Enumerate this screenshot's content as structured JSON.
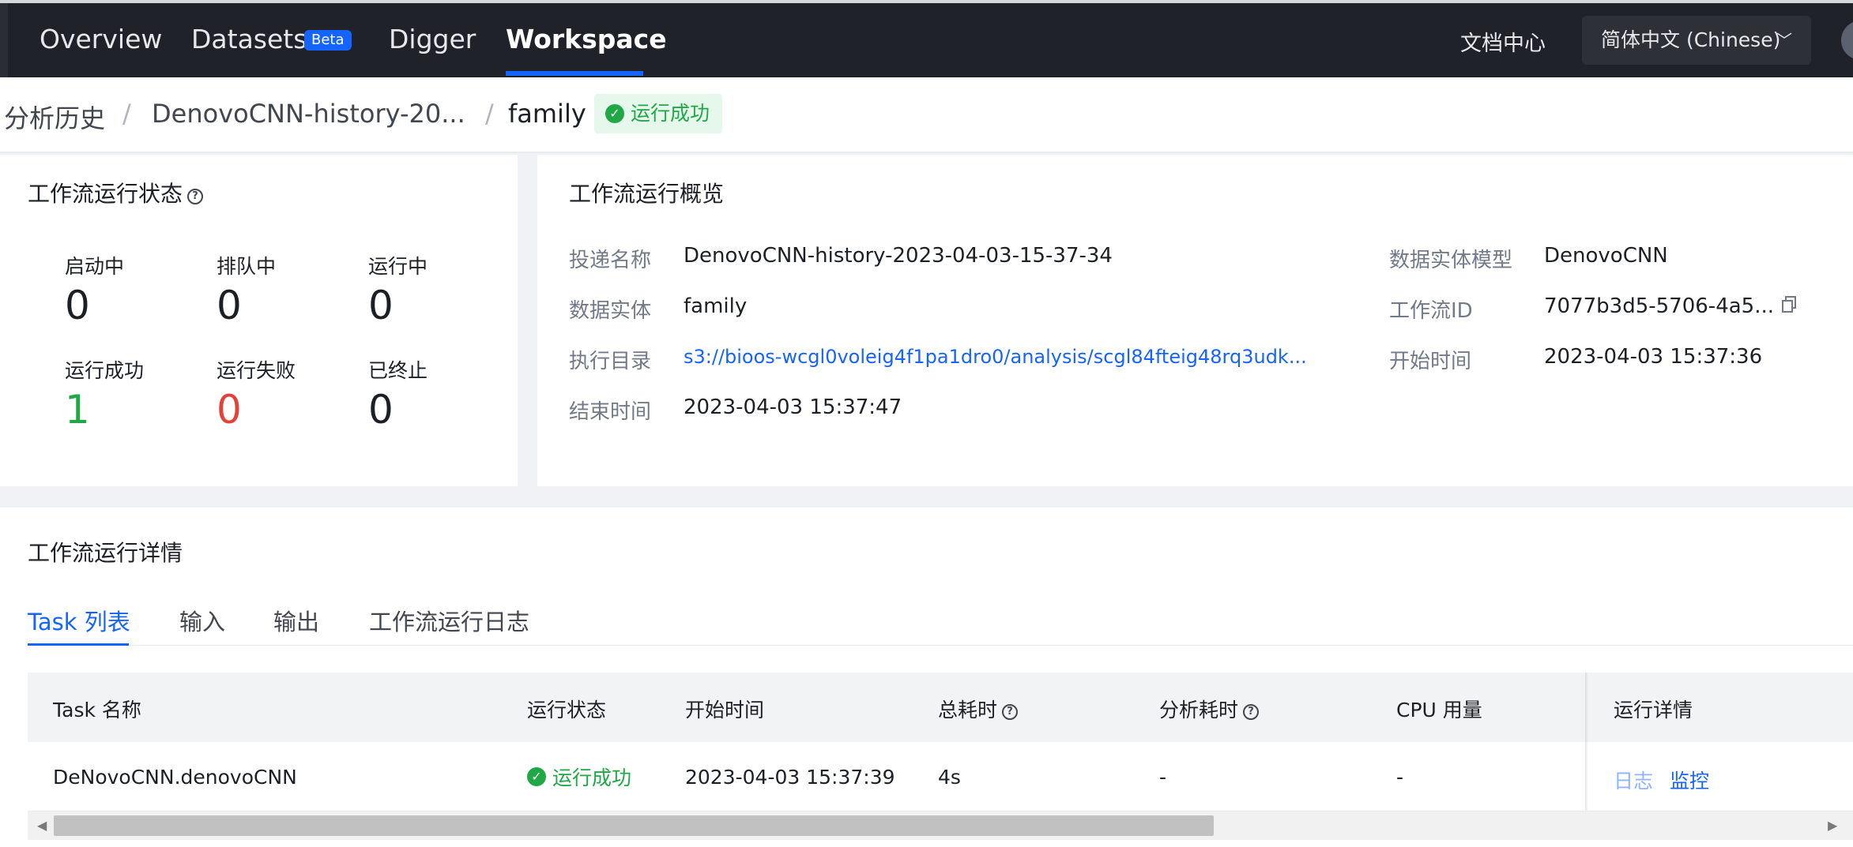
{
  "topnav": {
    "items": [
      {
        "label": "Overview"
      },
      {
        "label": "Datasets",
        "badge": "Beta"
      },
      {
        "label": "Digger"
      },
      {
        "label": "Workspace",
        "active": true
      }
    ],
    "doc_center": "文档中心",
    "language": "简体中文 (Chinese)"
  },
  "breadcrumb": {
    "items": [
      "分析历史",
      "DenovoCNN-history-20...",
      "family"
    ],
    "separator": "/",
    "status": "运行成功"
  },
  "run_status": {
    "title": "工作流运行状态",
    "stats": [
      {
        "label": "启动中",
        "value": "0"
      },
      {
        "label": "排队中",
        "value": "0"
      },
      {
        "label": "运行中",
        "value": "0"
      },
      {
        "label": "运行成功",
        "value": "1"
      },
      {
        "label": "运行失败",
        "value": "0"
      },
      {
        "label": "已终止",
        "value": "0"
      }
    ]
  },
  "overview": {
    "title": "工作流运行概览",
    "submission_name_label": "投递名称",
    "submission_name": "DenovoCNN-history-2023-04-03-15-37-34",
    "entity_label": "数据实体",
    "entity": "family",
    "exec_dir_label": "执行目录",
    "exec_dir": "s3://bioos-wcgl0voleig4f1pa1dro0/analysis/scgl84fteig48rq3udk...",
    "end_time_label": "结束时间",
    "end_time": "2023-04-03 15:37:47",
    "model_label": "数据实体模型",
    "model": "DenovoCNN",
    "workflow_id_label": "工作流ID",
    "workflow_id": "7077b3d5-5706-4a5...",
    "start_time_label": "开始时间",
    "start_time": "2023-04-03 15:37:36"
  },
  "details": {
    "title": "工作流运行详情",
    "tabs": [
      "Task 列表",
      "输入",
      "输出",
      "工作流运行日志"
    ],
    "columns": [
      "Task 名称",
      "运行状态",
      "开始时间",
      "总耗时",
      "分析耗时",
      "CPU 用量",
      "运行详情"
    ],
    "rows": [
      {
        "task": "DeNovoCNN.denovoCNN",
        "status": "运行成功",
        "start": "2023-04-03 15:37:39",
        "total": "4s",
        "analysis": "-",
        "cpu": "-",
        "log": "日志",
        "monitor": "监控"
      }
    ]
  },
  "colors": {
    "nav_bg": "#1f2329",
    "accent": "#1664ff",
    "success": "#1fa845",
    "error": "#e5413b"
  }
}
